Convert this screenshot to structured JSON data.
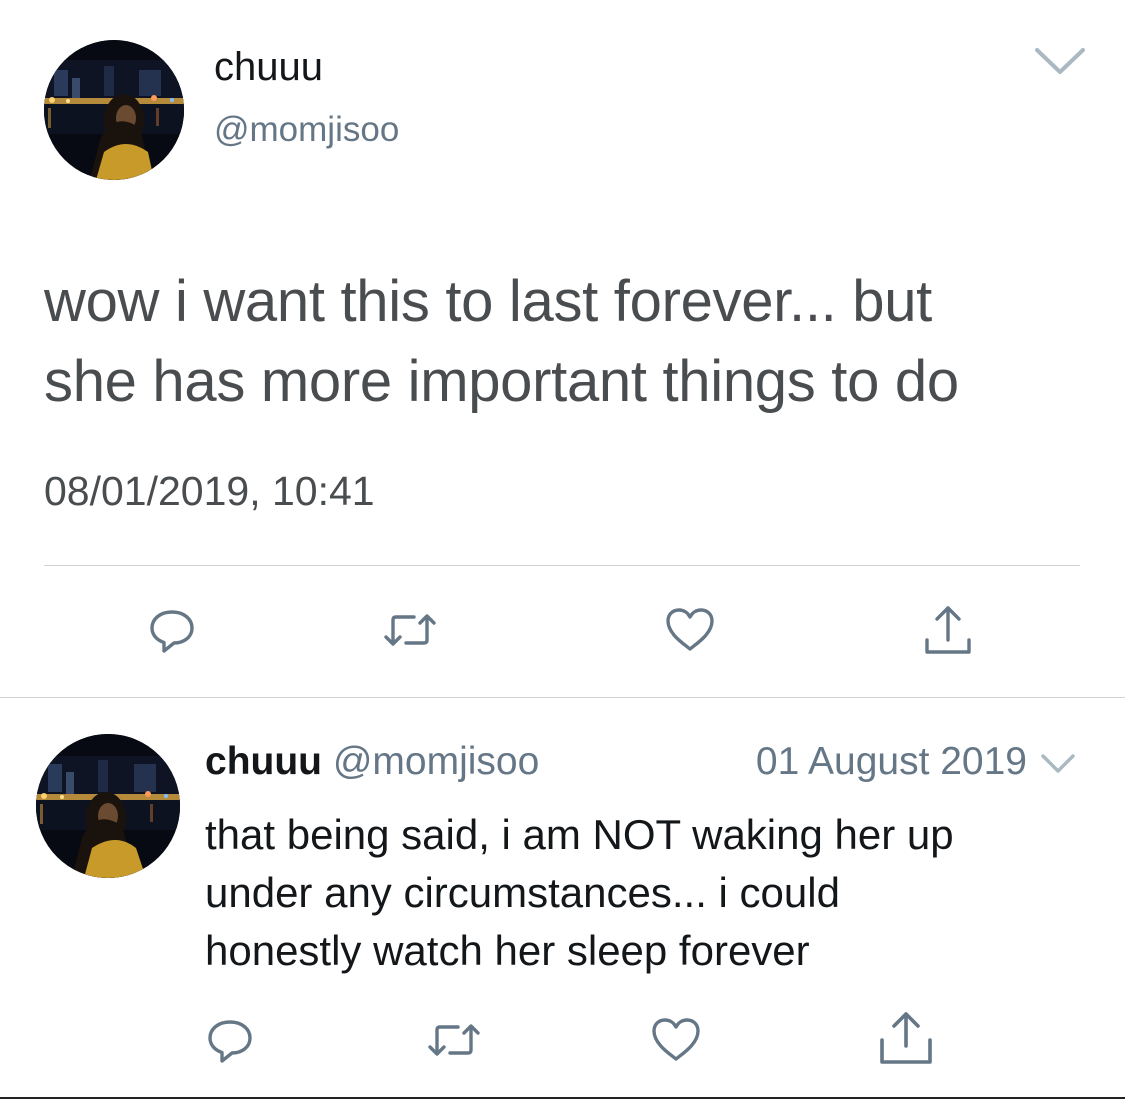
{
  "main_tweet": {
    "author_name": "chuuu",
    "author_handle": "@momjisoo",
    "text_line1": "wow i want this to last forever... but",
    "text_line2": "she has more important things to do",
    "timestamp": "08/01/2019, 10:41",
    "icons": [
      "avatar",
      "chevron-down-icon",
      "reply-icon",
      "retweet-icon",
      "like-icon",
      "share-icon"
    ]
  },
  "reply_tweet": {
    "author_name": "chuuu",
    "author_handle": "@momjisoo",
    "date": "01 August 2019",
    "text_line1": "that being said, i am NOT waking her up",
    "text_line2": "under any circumstances... i could",
    "text_line3": "honestly watch her sleep forever",
    "icons": [
      "avatar",
      "chevron-down-icon",
      "reply-icon",
      "retweet-icon",
      "like-icon",
      "share-icon"
    ]
  },
  "colors": {
    "primary_text": "#14171a",
    "secondary_text": "#657786",
    "icon_gray": "#657786",
    "divider": "#cfd4d8"
  }
}
